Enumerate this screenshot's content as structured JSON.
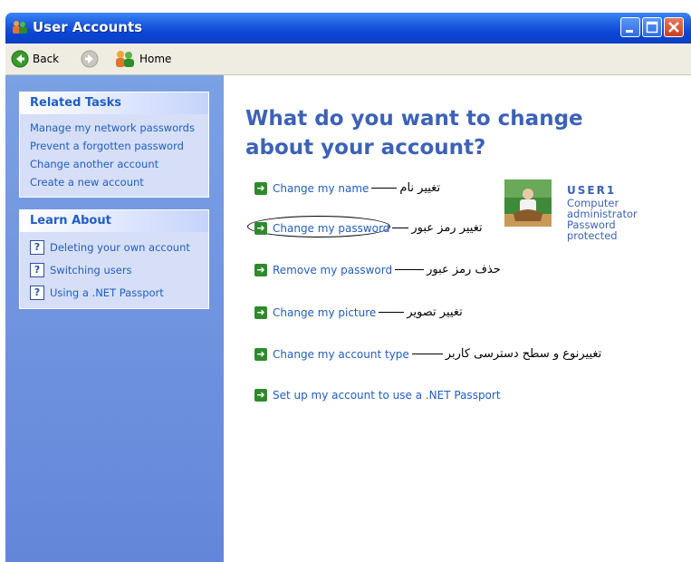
{
  "window": {
    "title": "User Accounts"
  },
  "toolbar": {
    "back_label": "Back",
    "home_label": "Home"
  },
  "sidebar": {
    "related_tasks": {
      "title": "Related Tasks",
      "items": [
        "Manage my network passwords",
        "Prevent a forgotten password",
        "Change another account",
        "Create a new account"
      ]
    },
    "learn_about": {
      "title": "Learn About",
      "items": [
        "Deleting your own account",
        "Switching users",
        "Using a .NET Passport"
      ]
    }
  },
  "main": {
    "title": "What do you want to change about your account?",
    "options": [
      {
        "label": "Change my name",
        "note": "تغییر نام"
      },
      {
        "label": "Change my password",
        "note": "تغییر رمز عبور"
      },
      {
        "label": "Remove my password",
        "note": "حذف رمز عبور"
      },
      {
        "label": "Change my picture",
        "note": "تغییر تصویر"
      },
      {
        "label": "Change my account type",
        "note": "تغییرنوع و سطح دسترسی کاربر"
      },
      {
        "label": "Set up my account to use a .NET Passport",
        "note": ""
      }
    ]
  },
  "user": {
    "name": "USER1",
    "role_line1": "Computer",
    "role_line2": "administrator",
    "status_line1": "Password",
    "status_line2": "protected"
  },
  "colors": {
    "titlebar": "#0a46d6",
    "sidebar": "#6f93dc",
    "link": "#215dc6",
    "heading": "#3c62b8",
    "arrow": "#2f8a2c"
  }
}
